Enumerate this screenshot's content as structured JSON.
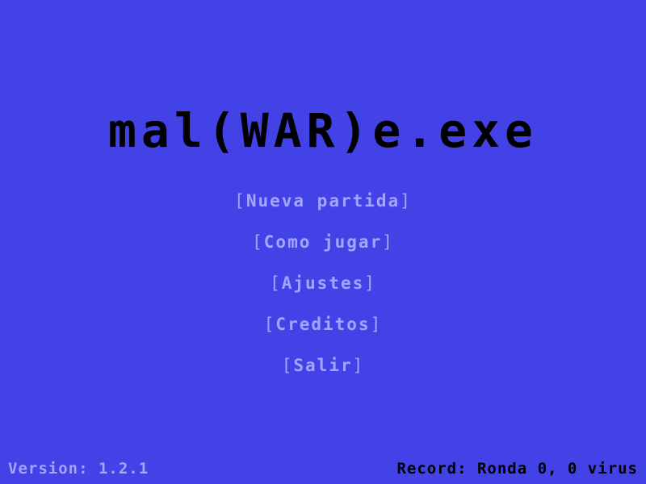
{
  "game": {
    "title": "mal(WAR)e.exe"
  },
  "menu": {
    "items": [
      {
        "id": "new-game",
        "label": "Nueva partida"
      },
      {
        "id": "how-to-play",
        "label": "Como jugar"
      },
      {
        "id": "settings",
        "label": "Ajustes"
      },
      {
        "id": "credits",
        "label": "Creditos"
      },
      {
        "id": "exit",
        "label": "Salir"
      }
    ]
  },
  "footer": {
    "version": "Version: 1.2.1",
    "record": "Record: Ronda 0, 0 virus"
  },
  "colors": {
    "background": "#4242e7",
    "title": "#000000",
    "menu_text": "#a5a5ff",
    "version_text": "#a5a5ff",
    "record_text": "#000000"
  }
}
